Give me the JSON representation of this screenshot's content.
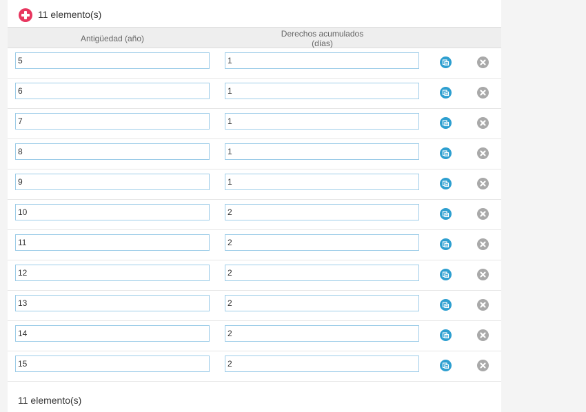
{
  "header": {
    "count_label": "11 elemento(s)"
  },
  "columns": {
    "antiguedad": "Antigüedad (año)",
    "derechos_line1": "Derechos acumulados",
    "derechos_line2": "(días)"
  },
  "rows": [
    {
      "antiguedad": "5",
      "derechos": "1"
    },
    {
      "antiguedad": "6",
      "derechos": "1"
    },
    {
      "antiguedad": "7",
      "derechos": "1"
    },
    {
      "antiguedad": "8",
      "derechos": "1"
    },
    {
      "antiguedad": "9",
      "derechos": "1"
    },
    {
      "antiguedad": "10",
      "derechos": "2"
    },
    {
      "antiguedad": "11",
      "derechos": "2"
    },
    {
      "antiguedad": "12",
      "derechos": "2"
    },
    {
      "antiguedad": "13",
      "derechos": "2"
    },
    {
      "antiguedad": "14",
      "derechos": "2"
    },
    {
      "antiguedad": "15",
      "derechos": "2"
    }
  ],
  "footer": {
    "count_label": "11 elemento(s)"
  },
  "icons": {
    "add": "plus-circle-icon",
    "copy": "duplicate-icon",
    "delete": "close-circle-icon"
  },
  "colors": {
    "add": "#e8365f",
    "copy": "#2e9fd0",
    "delete": "#a9a9a9",
    "input_border": "#9ccce8"
  }
}
